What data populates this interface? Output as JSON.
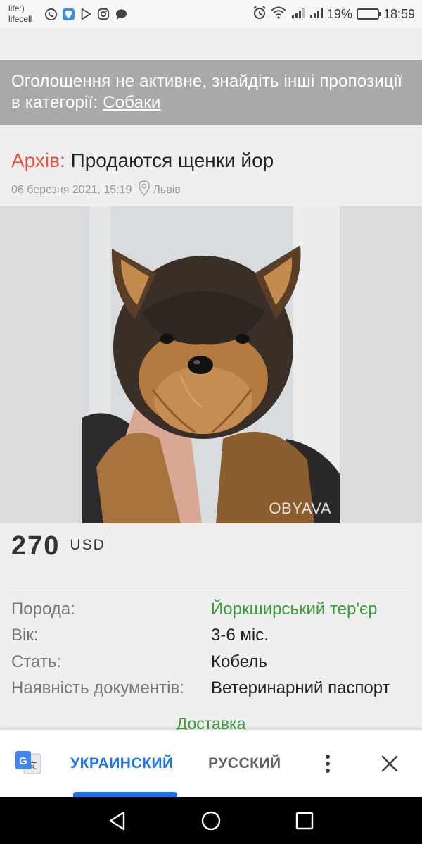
{
  "status_bar": {
    "carrier_line1": "life:)",
    "carrier_line2": "lifecell",
    "left_icons": [
      "viber-icon",
      "shield-app-icon",
      "play-store-icon",
      "instagram-icon",
      "chat-icon"
    ],
    "battery_percent": "19%",
    "battery_level": 0.19,
    "time": "18:59",
    "colors": {
      "battery": "#f2a000"
    }
  },
  "notice": {
    "text": "Оголошення не активне, знайдіть інші пропозиції в категорії: ",
    "link": "Собаки"
  },
  "listing": {
    "archive_label": "Архів:",
    "title": "Продаются щенки йор",
    "date": "06 березня 2021, 15:19",
    "location": "Львів",
    "watermark": "OBYAVA",
    "price": "270",
    "currency": "USD"
  },
  "attributes": [
    {
      "key": "Порода:",
      "value": "Йоркширський тер'єр",
      "is_link": true
    },
    {
      "key": "Вік:",
      "value": "3-6 міс.",
      "is_link": false
    },
    {
      "key": "Стать:",
      "value": "Кобель",
      "is_link": false
    },
    {
      "key": "Наявність документів:",
      "value": "Ветеринарний паспорт",
      "is_link": false
    }
  ],
  "delivery_label": "Доставка",
  "translate_bar": {
    "lang_active": "УКРАИНСКИЙ",
    "lang_other": "РУССКИЙ"
  },
  "colors": {
    "accent_green": "#3a9d3a",
    "archive_red": "#e5533f",
    "translate_blue": "#1a73e8",
    "notice_bg": "#a9a9a9"
  }
}
